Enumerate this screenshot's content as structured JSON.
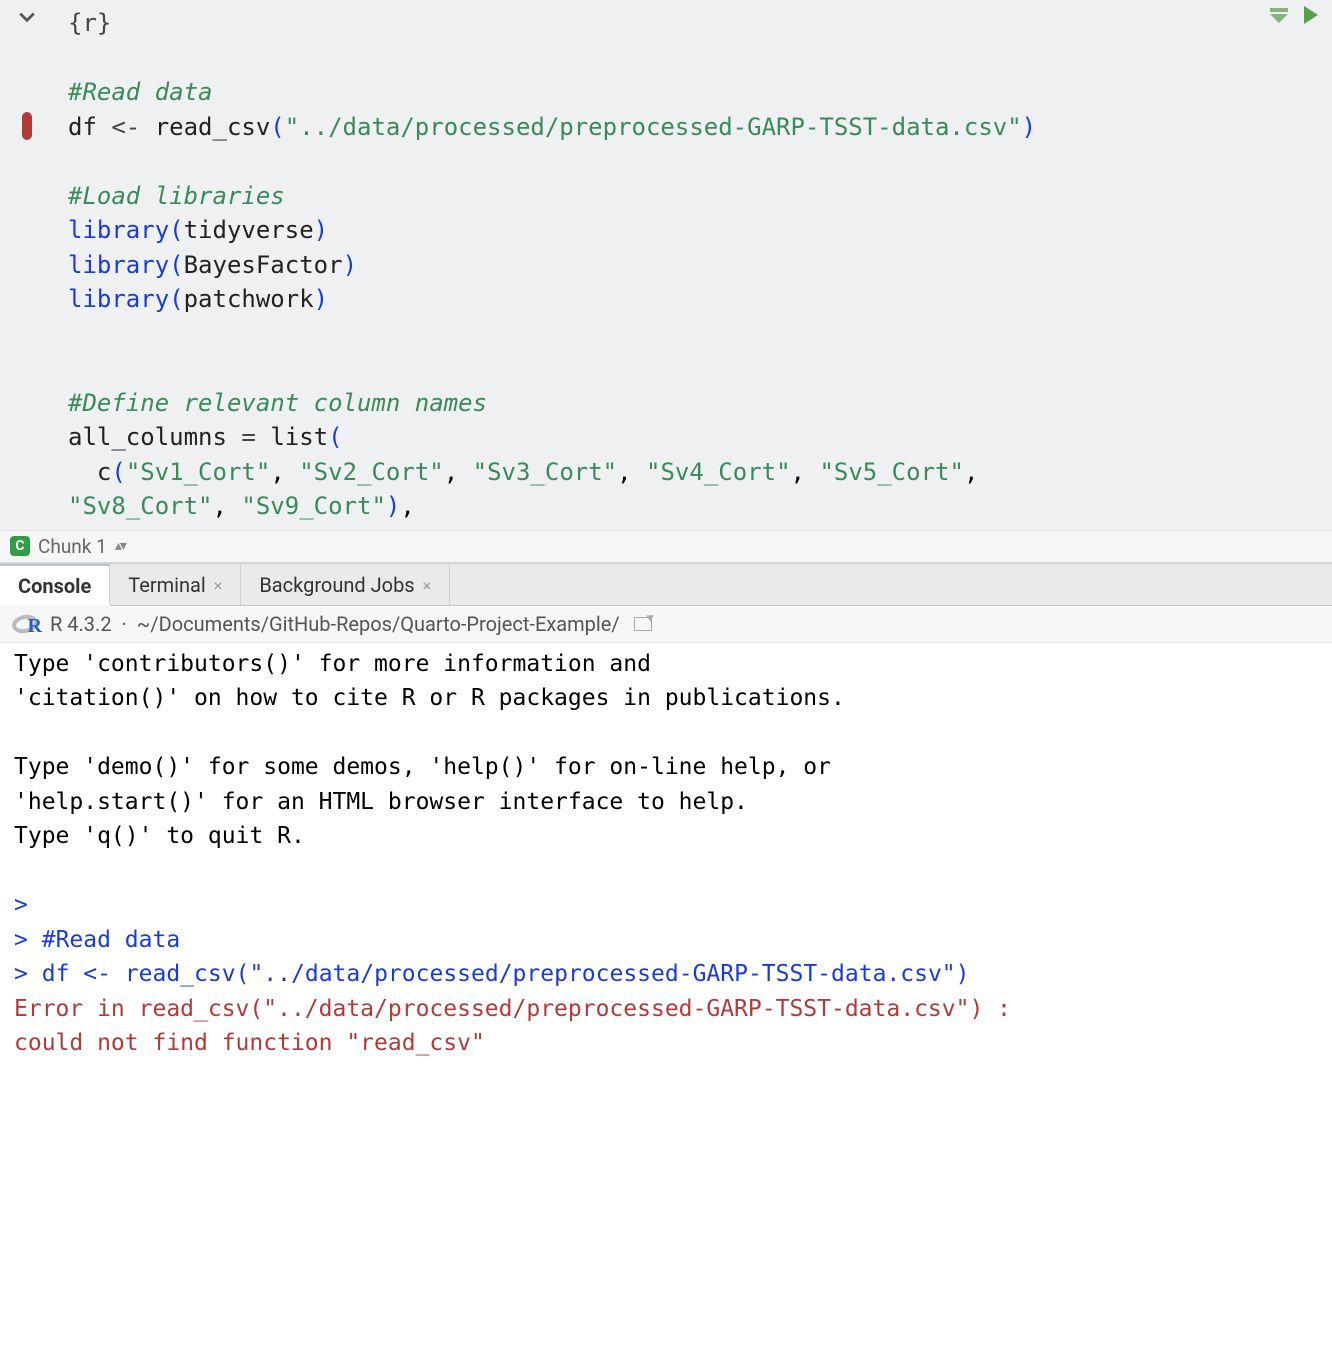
{
  "editor": {
    "chunk_header": "{r}",
    "lines": {
      "l2_comment": "#Read data",
      "l3_var": "df",
      "l3_assign": " <- ",
      "l3_fn": "read_csv",
      "l3_str": "\"../data/processed/preprocessed-GARP-TSST-data.csv\"",
      "l5_comment": "#Load libraries",
      "l6_fn": "library",
      "l6_arg": "tidyverse",
      "l7_fn": "library",
      "l7_arg": "BayesFactor",
      "l8_fn": "library",
      "l8_arg": "patchwork",
      "l11_comment": "#Define relevant column names",
      "l12_var": "all_columns",
      "l12_eq": " = ",
      "l12_fn": "list",
      "l13_fn": "c",
      "l13_items": [
        "\"Sv1_Cort\"",
        "\"Sv2_Cort\"",
        "\"Sv3_Cort\"",
        "\"Sv4_Cort\"",
        "\"Sv5_Cort\""
      ],
      "l14_items": [
        "\"Sv8_Cort\"",
        "\"Sv9_Cort\""
      ]
    },
    "chunk_footer_label": "Chunk 1"
  },
  "tabs": {
    "console": "Console",
    "terminal": "Terminal",
    "jobs": "Background Jobs"
  },
  "console": {
    "r_version": "R 4.3.2",
    "sep": "·",
    "path": "~/Documents/GitHub-Repos/Quarto-Project-Example/",
    "out1": "Type 'contributors()' for more information and",
    "out2": "'citation()' on how to cite R or R packages in publications.",
    "out3": "Type 'demo()' for some demos, 'help()' for on-line help, or",
    "out4": "'help.start()' for an HTML browser interface to help.",
    "out5": "Type 'q()' to quit R.",
    "prompt": ">",
    "in1_comment": "#Read data",
    "in2_var": "df",
    "in2_assign": " <- ",
    "in2_fn": "read_csv",
    "in2_str": "\"../data/processed/preprocessed-GARP-TSST-data.csv\"",
    "err1": "Error in read_csv(\"../data/processed/preprocessed-GARP-TSST-data.csv\") : ",
    "err2": "  could not find function \"read_csv\""
  }
}
